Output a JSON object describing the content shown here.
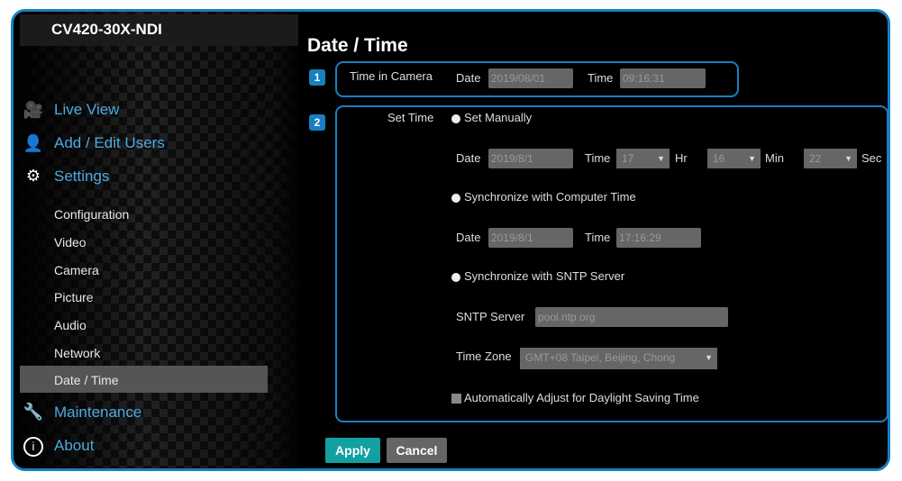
{
  "app_title": "CV420-30X-NDI",
  "nav": {
    "live_view": "Live View",
    "users": "Add / Edit Users",
    "settings": "Settings",
    "maintenance": "Maintenance",
    "about": "About"
  },
  "settings_items": [
    "Configuration",
    "Video",
    "Camera",
    "Picture",
    "Audio",
    "Network",
    "Date / Time"
  ],
  "page_title": "Date / Time",
  "badges": [
    "1",
    "2"
  ],
  "camera": {
    "label": "Time in Camera",
    "date_label": "Date",
    "date": "2019/08/01",
    "time_label": "Time",
    "time": "09:16:31"
  },
  "set_time": {
    "label": "Set Time",
    "manual": {
      "label": "Set Manually",
      "date_label": "Date",
      "date": "2019/8/1",
      "time_label": "Time",
      "hr": "17",
      "hr_label": "Hr",
      "min": "16",
      "min_label": "Min",
      "sec": "22",
      "sec_label": "Sec"
    },
    "computer": {
      "label": "Synchronize with Computer Time",
      "date_label": "Date",
      "date": "2019/8/1",
      "time_label": "Time",
      "time": "17:16:29"
    },
    "sntp": {
      "label": "Synchronize with SNTP Server",
      "server_label": "SNTP Server",
      "server": "pool.ntp.org",
      "tz_label": "Time Zone",
      "tz": "GMT+08 Taipei, Beijing, Chong"
    },
    "dst_label": "Automatically Adjust for Daylight Saving Time"
  },
  "buttons": {
    "apply": "Apply",
    "cancel": "Cancel"
  },
  "colors": {
    "accent": "#1a7fc1",
    "apply": "#13a0a0"
  }
}
